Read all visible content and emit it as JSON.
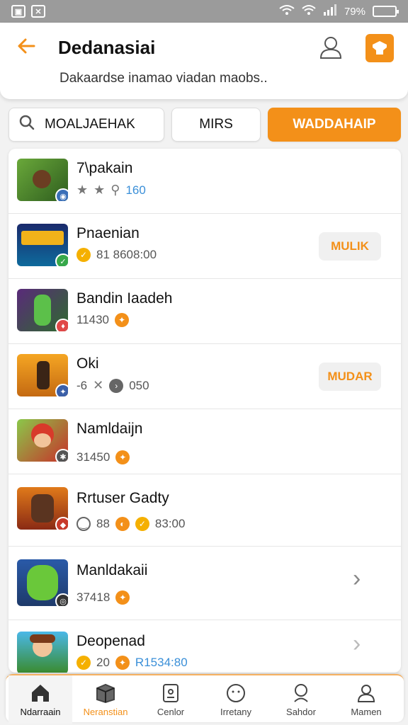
{
  "status": {
    "time": "",
    "battery": "79%"
  },
  "header": {
    "title": "Dedanasiai",
    "subtitle": "Dakaardse inamao viadan maobs.."
  },
  "tabs": [
    {
      "label": "MOALJAEHAK"
    },
    {
      "label": "MIRS"
    },
    {
      "label": "WADDAHAIP"
    }
  ],
  "list": [
    {
      "title": "7\\pakain",
      "meta_a": "160",
      "action": ""
    },
    {
      "title": "Pnaenian",
      "meta_a": "81 8608:00",
      "action": "MULIK"
    },
    {
      "title": "Bandin Iaadeh",
      "meta_a": "11430",
      "action": ""
    },
    {
      "title": "Oki",
      "meta_a": "-6",
      "meta_b": "050",
      "action": "MUDAR"
    },
    {
      "title": "Namldaijn",
      "meta_a": "31450",
      "action": ""
    },
    {
      "title": "Rrtuser Gadty",
      "meta_a": "88",
      "meta_b": "83:00",
      "action": ""
    },
    {
      "title": "Manldakaii",
      "meta_a": "37418",
      "action": ""
    },
    {
      "title": "Deopenad",
      "meta_a": "20",
      "meta_b": "R1534:80",
      "action": ""
    }
  ],
  "bottom_nav": [
    {
      "label": "Ndarraain"
    },
    {
      "label": "Neranstian"
    },
    {
      "label": "Cenlor"
    },
    {
      "label": "Irretany"
    },
    {
      "label": "Sahdor"
    },
    {
      "label": "Mamen"
    }
  ],
  "colors": {
    "accent": "#f39019",
    "status_bar": "#9b9b9b"
  }
}
